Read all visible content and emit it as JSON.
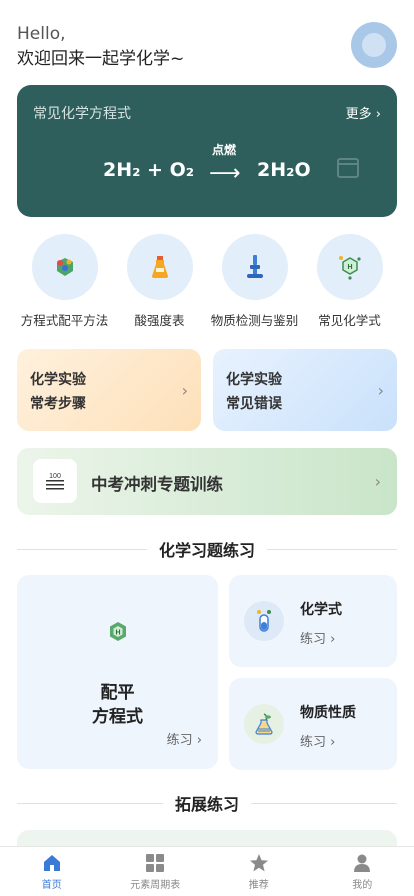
{
  "header": {
    "greeting": "Hello,",
    "welcome": "欢迎回来一起学化学~"
  },
  "equation_card": {
    "title": "常见化学方程式",
    "more": "更多 ›",
    "condition": "点燃",
    "left_side": "2H₂ + O₂",
    "arrow": "⟶",
    "right_side": "2H₂O"
  },
  "quick_entries": [
    {
      "label": "方程式配平方法",
      "icon": "molecule-shield-icon"
    },
    {
      "label": "酸强度表",
      "icon": "flask-icon"
    },
    {
      "label": "物质检测与鉴别",
      "icon": "microscope-icon"
    },
    {
      "label": "常见化学式",
      "icon": "hexagon-h-icon"
    }
  ],
  "tips": [
    {
      "line1": "化学实验",
      "line2": "常考步骤",
      "chevron": "›"
    },
    {
      "line1": "化学实验",
      "line2": "常见错误",
      "chevron": "›"
    }
  ],
  "sprint": {
    "title": "中考冲刺专题训练",
    "badge": "100",
    "chevron": "›"
  },
  "practice_section": {
    "title": "化学习题练习"
  },
  "practice": {
    "big": {
      "title_line1": "配平",
      "title_line2": "方程式",
      "sub": "练习 ›",
      "icon": "hexagon-h-icon"
    },
    "small": [
      {
        "title": "化学式",
        "sub": "练习 ›",
        "icon": "test-tube-icon"
      },
      {
        "title": "物质性质",
        "sub": "练习 ›",
        "icon": "flask-plant-icon"
      }
    ]
  },
  "extension_section": {
    "title": "拓展练习"
  },
  "tabbar": [
    {
      "label": "首页",
      "icon": "home-icon",
      "active": true
    },
    {
      "label": "元素周期表",
      "icon": "grid-icon",
      "active": false
    },
    {
      "label": "推荐",
      "icon": "star-icon",
      "active": false
    },
    {
      "label": "我的",
      "icon": "user-icon",
      "active": false
    }
  ],
  "colors": {
    "accent": "#3b7bd8",
    "equation_bg": "#2f5f5c"
  }
}
